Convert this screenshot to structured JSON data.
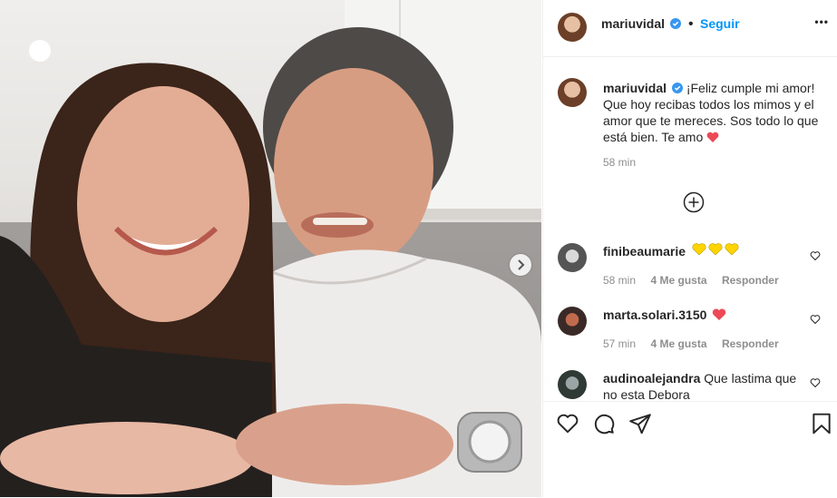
{
  "post": {
    "username": "mariuvidal",
    "follow_label": "Seguir",
    "dot": "•",
    "more_label": "•••",
    "caption": "¡Feliz cumple mi amor! Que hoy recibas todos los mimos y el amor que te mereces. Sos todo lo que está bien. Te amo",
    "caption_emoji": "heart",
    "caption_time": "58 min",
    "load_more_icon": "plus-circle-icon"
  },
  "comments": [
    {
      "username": "finibeaumarie",
      "text": "",
      "emoji": "yellow-hearts",
      "time": "58 min",
      "likes": "4 Me gusta",
      "reply": "Responder"
    },
    {
      "username": "marta.solari.3150",
      "text": "",
      "emoji": "red-heart",
      "time": "57 min",
      "likes": "4 Me gusta",
      "reply": "Responder"
    },
    {
      "username": "audinoalejandra",
      "text": "Que lastima que no esta Debora",
      "emoji": "",
      "time": "",
      "likes": "",
      "reply": ""
    }
  ],
  "actions": {
    "icons": [
      "heart-icon",
      "comment-icon",
      "share-icon",
      "bookmark-icon"
    ]
  },
  "colors": {
    "accent": "#0095f6",
    "heart": "#ed4956",
    "verified": "#3897f0",
    "yellow": "#ffd400"
  }
}
